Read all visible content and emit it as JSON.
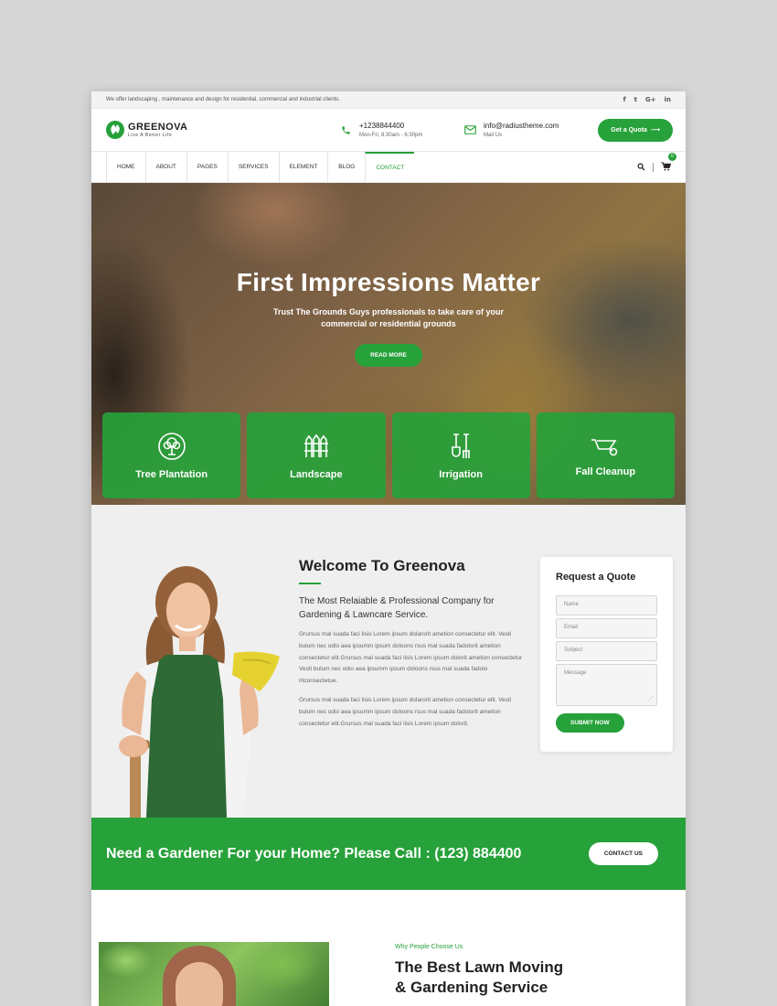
{
  "topbar": {
    "text": "We offer landscaping , maintenance and design for residential, commercial and industrial clients.",
    "social": [
      "f",
      "t",
      "G+",
      "in"
    ]
  },
  "header": {
    "logo_name": "GREENOVA",
    "logo_tagline": "Live A Better Life",
    "phone": "+1238844400",
    "hours": "Mon-Fri, 8:30am - 6:30pm",
    "email": "info@radiustheme.com",
    "email_label": "Mail Us",
    "quota_button": "Get a Quota",
    "quota_arrow": "⟶"
  },
  "nav": {
    "items": [
      "HOME",
      "ABOUT",
      "PAGES",
      "SERVICES",
      "ELEMENT",
      "BLOG",
      "CONTACT"
    ],
    "active": "CONTACT",
    "cart_count": "0"
  },
  "hero": {
    "title": "First Impressions Matter",
    "subtitle": "Trust The Grounds Guys professionals to take care of your commercial or residential grounds",
    "button": "READ MORE",
    "services": [
      {
        "label": "Tree Plantation",
        "icon": "tree-icon"
      },
      {
        "label": "Landscape",
        "icon": "fence-icon"
      },
      {
        "label": "Irrigation",
        "icon": "shovel-icon"
      },
      {
        "label": "Fall Cleanup",
        "icon": "wheelbarrow-icon"
      }
    ]
  },
  "welcome": {
    "title": "Welcome To Greenova",
    "lead": "The Most Relaiable & Professional Company for Gardening & Lawncare Service.",
    "para1": "Grursus mal suada faci lisis Lorem ipsum dolarorit ametion consectetur elit. Vesti bulum nec odio aea ipsumm ipsum doloons rsus mal suada fadolorit ametion consectetur elit.Grursus mal suada faci lisis Lorem ipsum dolorit ametion consectetur Vesti bulum nec odio aea ipsumm ipsum doloons rsus mal suada fadolo ritconsectetue.",
    "para2": "Grursus mal suada faci lisis Lorem ipsum dolarorit ametion consectetur elit. Vesti bulum nec odio aea ipsumm ipsum doloons rsus mal suada fadolorit ametion consectetur elit.Grursus mal suada faci lisis Lorem ipsum dolorit."
  },
  "quote_form": {
    "title": "Request a Quote",
    "name_placeholder": "Name",
    "email_placeholder": "Email",
    "subject_placeholder": "Subject",
    "message_placeholder": "Message",
    "submit": "SUBMIT NOW"
  },
  "cta": {
    "text": "Need a Gardener For your Home? Please Call : (123) 884400",
    "button": "CONTACT US"
  },
  "why": {
    "kicker": "Why People Choose Us",
    "title_line1": "The Best Lawn Moving",
    "title_line2": "& Gardening Service"
  },
  "colors": {
    "accent": "#27a13a",
    "page_bg": "#d6d6d6",
    "section_bg": "#efefef"
  }
}
